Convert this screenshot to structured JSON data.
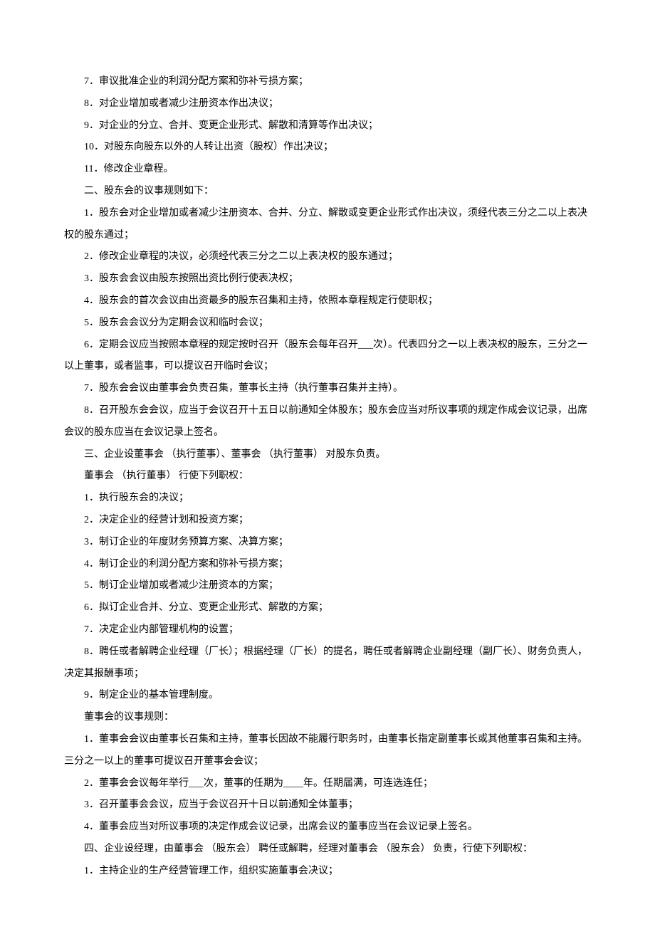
{
  "lines": [
    "7．审议批准企业的利润分配方案和弥补亏损方案；",
    "8．对企业增加或者减少注册资本作出决议；",
    "9．对企业的分立、合并、变更企业形式、解散和清算等作出决议；",
    "10．对股东向股东以外的人转让出资（股权）作出决议；",
    "11．修改企业章程。",
    "二、股东会的议事规则如下：",
    "1．股东会对企业增加或者减少注册资本、合并、分立、解散或变更企业形式作出决议，须经代表三分之二以上表决权的股东通过；",
    "2．修改企业章程的决议，必须经代表三分之二以上表决权的股东通过；",
    "3．股东会会议由股东按照出资比例行使表决权；",
    "4．股东会的首次会议由出资最多的股东召集和主持，依照本章程规定行使职权；",
    "5．股东会会议分为定期会议和临时会议；",
    "6．定期会议应当按照本章程的规定按时召开（股东会每年召开___次）。代表四分之一以上表决权的股东，三分之一以上董事，或者监事，可以提议召开临时会议；",
    "7．股东会会议由董事会负责召集，董事长主持（执行董事召集并主持）。",
    "8．召开股东会会议，应当于会议召开十五日以前通知全体股东；股东会应当对所议事项的规定作成会议记录，出席会议的股东应当在会议记录上签名。",
    "三、企业设董事会 （执行董事）、董事会 （执行董事） 对股东负责。",
    "董事会 （执行董事） 行使下列职权：",
    "1．执行股东会的决议；",
    "2．决定企业的经营计划和投资方案；",
    "3．制订企业的年度财务预算方案、决算方案；",
    "4．制订企业的利润分配方案和弥补亏损方案；",
    "5．制订企业增加或者减少注册资本的方案；",
    "6．拟订企业合并、分立、变更企业形式、解散的方案；",
    "7．决定企业内部管理机构的设置；",
    "8．聘任或者解聘企业经理（厂长）；根据经理（厂长）的提名，聘任或者解聘企业副经理（副厂长）、财务负责人，决定其报酬事项；",
    "9．制定企业的基本管理制度。",
    "董事会的议事规则：",
    "1．董事会会议由董事长召集和主持，董事长因故不能履行职务时，由董事长指定副董事长或其他董事召集和主持。三分之一以上的董事可提议召开董事会会议；",
    "2．董事会会议每年举行___次，董事的任期为____年。任期届满，可连选连任；",
    "3．召开董事会会议，应当于会议召开十日以前通知全体董事；",
    "4．董事会应当对所议事项的决定作成会议记录，出席会议的董事应当在会议记录上签名。",
    "四、企业设经理，由董事会 （股东会） 聘任或解聘，经理对董事会 （股东会） 负责，行使下列职权：",
    "1．主持企业的生产经营管理工作，组织实施董事会决议；"
  ]
}
